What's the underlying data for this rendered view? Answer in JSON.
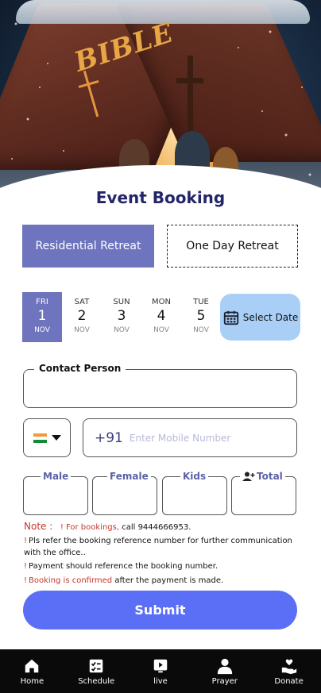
{
  "hero": {
    "book_title": "BIBLE"
  },
  "page": {
    "title": "Event Booking"
  },
  "retreat": {
    "residential_label": "Residential Retreat",
    "one_day_label": "One Day Retreat"
  },
  "dates": [
    {
      "weekday": "FRI",
      "day": "1",
      "month": "NOV",
      "selected": true
    },
    {
      "weekday": "SAT",
      "day": "2",
      "month": "NOV",
      "selected": false
    },
    {
      "weekday": "SUN",
      "day": "3",
      "month": "NOV",
      "selected": false
    },
    {
      "weekday": "MON",
      "day": "4",
      "month": "NOV",
      "selected": false
    },
    {
      "weekday": "TUE",
      "day": "5",
      "month": "NOV",
      "selected": false
    }
  ],
  "select_date": {
    "label": "Select Date",
    "icon": "calendar-icon"
  },
  "contact": {
    "label": "Contact Person",
    "value": ""
  },
  "phone": {
    "country_code": "+91",
    "placeholder": "Enter Mobile Number",
    "country_flag": "india-flag-icon"
  },
  "counts": {
    "male_label": "Male",
    "female_label": "Female",
    "kids_label": "Kids",
    "total_label": "Total",
    "total_icon": "add-user-icon"
  },
  "notes": {
    "heading": "Note :",
    "line1_red": "! For bookings,",
    "line1_rest": " call 9444666953.",
    "line2": "Pls refer the booking reference number for further communication with the office..",
    "line3": "Payment should reference the booking number.",
    "line4_red": "Booking is confirmed",
    "line4_rest": " after the payment is made."
  },
  "submit_label": "Submit",
  "nav": [
    {
      "label": "Home",
      "icon": "home-icon"
    },
    {
      "label": "Schedule",
      "icon": "schedule-icon"
    },
    {
      "label": "live",
      "icon": "live-icon"
    },
    {
      "label": "Prayer",
      "icon": "prayer-icon"
    },
    {
      "label": "Donate",
      "icon": "donate-icon"
    }
  ],
  "colors": {
    "primary": "#6e74bd",
    "submit": "#5a6ff5",
    "select_date_bg": "#a9cff7",
    "note_red": "#c0392b",
    "title": "#23256a"
  }
}
